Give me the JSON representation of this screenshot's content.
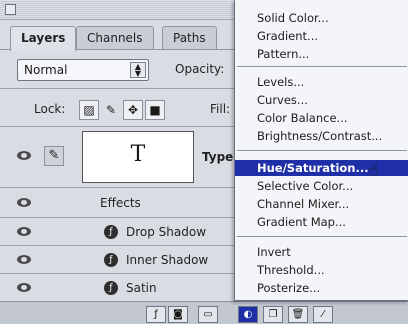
{
  "palette": {
    "tabs": [
      "Layers",
      "Channels",
      "Paths"
    ],
    "blend_mode": "Normal",
    "opacity_label": "Opacity:",
    "lock_label": "Lock:",
    "fill_label": "Fill:",
    "type_layer_thumb": "T",
    "type_layer_name": "Type",
    "effects_label": "Effects",
    "effects": [
      "Drop Shadow",
      "Inner Shadow",
      "Satin"
    ]
  },
  "menu": {
    "groups": [
      [
        "Solid Color...",
        "Gradient...",
        "Pattern..."
      ],
      [
        "Levels...",
        "Curves...",
        "Color Balance...",
        "Brightness/Contrast..."
      ],
      [
        "Hue/Saturation...",
        "Selective Color...",
        "Channel Mixer...",
        "Gradient Map..."
      ],
      [
        "Invert",
        "Threshold...",
        "Posterize..."
      ]
    ],
    "highlighted": "Hue/Saturation..."
  },
  "colors": {
    "highlight": "#1e2fa8",
    "panel_bg": "#d9dde3",
    "menu_bg": "#f3f5f8"
  }
}
